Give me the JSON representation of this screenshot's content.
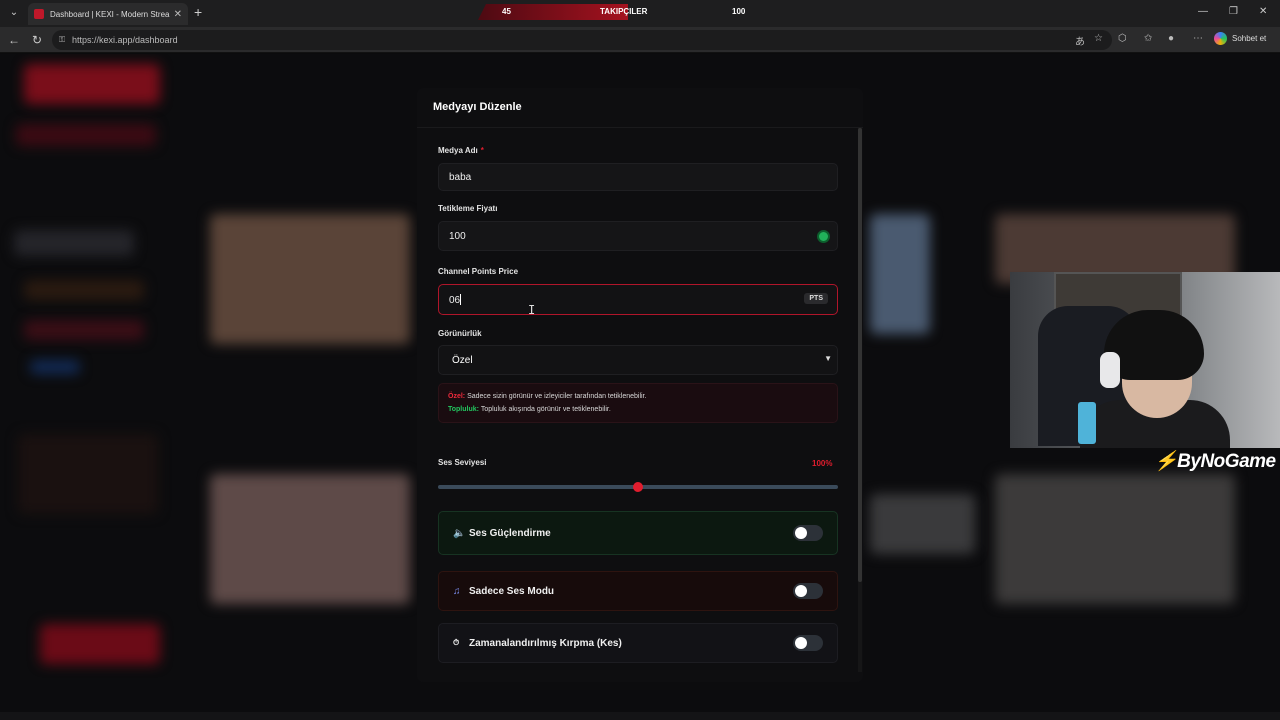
{
  "browser": {
    "tab_title": "Dashboard | KEXI - Modern Stream",
    "url": "https://kexi.app/dashboard",
    "profile_button": "Sohbet et"
  },
  "overlay": {
    "followers_current": "45",
    "followers_label": "TAKIPÇILER",
    "followers_goal": "100",
    "brand": "ByNoGame"
  },
  "modal": {
    "title": "Medyayı Düzenle",
    "media_name_label": "Medya Adı",
    "media_name_required": "*",
    "media_name_value": "baba",
    "trigger_price_label": "Tetikleme Fiyatı",
    "trigger_price_value": "100",
    "channel_points_label": "Channel Points Price",
    "channel_points_value": "06",
    "channel_points_unit": "PTS",
    "visibility_label": "Görünürlük",
    "visibility_value": "Özel",
    "info_private_label": "Özel:",
    "info_private_text": "Sadece sizin görünür ve izleyiciler tarafından tetiklenebilir.",
    "info_community_label": "Topluluk:",
    "info_community_text": "Topluluk akışında görünür ve tetiklenebilir.",
    "volume_label": "Ses Seviyesi",
    "volume_value": "100%",
    "volume_level": 0.5,
    "toggles": [
      {
        "label": "Ses Güçlendirme",
        "icon": "speaker-icon",
        "on": false
      },
      {
        "label": "Sadece Ses Modu",
        "icon": "music-note-icon",
        "on": false
      },
      {
        "label": "Zamanalandırılmış Kırpma (Kes)",
        "icon": "timer-icon",
        "on": false
      }
    ]
  },
  "colors": {
    "accent_red": "#e11d2e",
    "accent_green": "#22c55e"
  }
}
